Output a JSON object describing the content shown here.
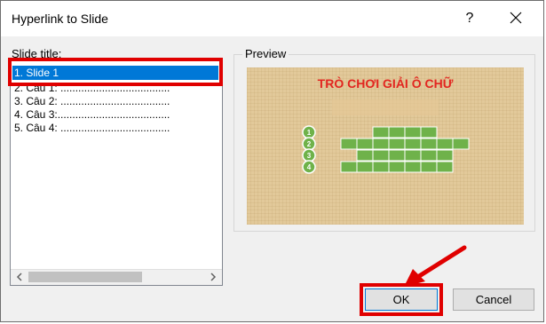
{
  "window": {
    "title": "Hyperlink to Slide",
    "help": "?"
  },
  "slide_list": {
    "label": "Slide title:",
    "items": [
      "1. Slide 1",
      "2. Câu 1: .....................................",
      "3. Câu 2: .....................................",
      "4. Câu 3:......................................",
      "5. Câu 4: ....................................."
    ],
    "selected_index": 0
  },
  "preview": {
    "label": "Preview",
    "slide_title": "TRÒ CHƠI GIẢI Ô CHỮ",
    "row_numbers": [
      "1",
      "2",
      "3",
      "4"
    ]
  },
  "buttons": {
    "ok": "OK",
    "cancel": "Cancel"
  },
  "colors": {
    "accent": "#0078d7",
    "highlight_red": "#e00000",
    "cell_green": "#7cb85a",
    "title_red": "#e22620"
  }
}
